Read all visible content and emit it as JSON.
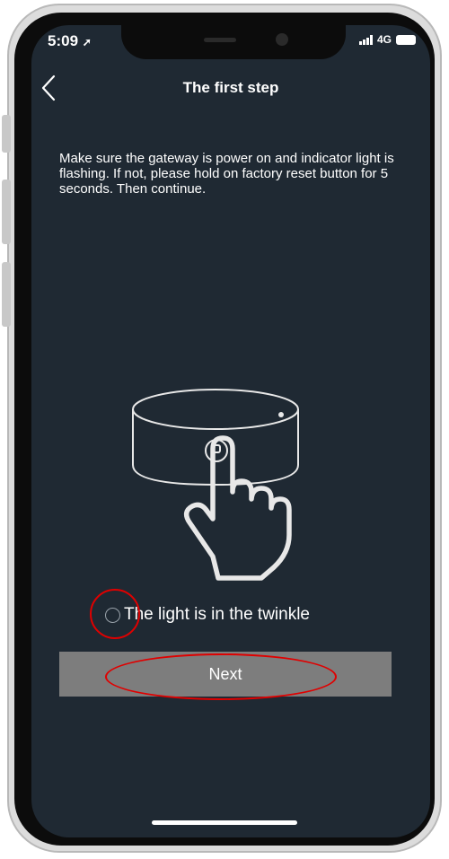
{
  "status_bar": {
    "time": "5:09",
    "network": "4G"
  },
  "nav": {
    "title": "The first step"
  },
  "instructions": "Make sure the gateway is power on and indicator light is flashing. If not, please hold on factory reset button for 5 seconds. Then continue.",
  "option": {
    "label": "The light is in the twinkle",
    "checked": false
  },
  "next_button": {
    "label": "Next"
  },
  "colors": {
    "screen_background": "#1f2933",
    "button_background": "#7d7d7d",
    "annotation_red": "#e00000"
  },
  "icons": [
    "back-chevron-icon",
    "location-arrow-icon",
    "signal-icon",
    "battery-icon",
    "gateway-hand-press-icon"
  ]
}
